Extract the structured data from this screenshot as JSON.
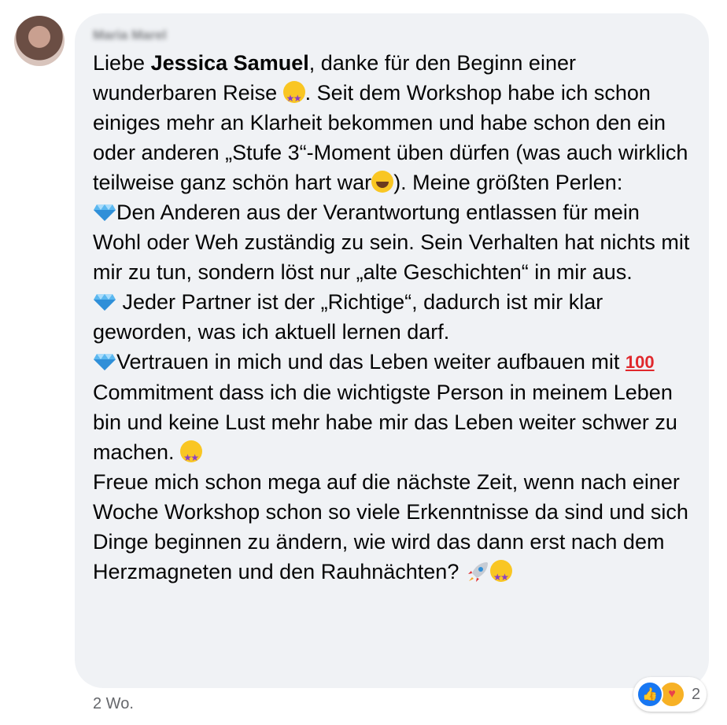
{
  "comment": {
    "author": "Maria Marel",
    "greeting": "Liebe ",
    "mention": "Jessica Samuel",
    "p1a": ", danke für den Beginn einer wunderbaren Reise ",
    "p1b": ". Seit dem Workshop habe ich schon einiges mehr an Klarheit bekommen und habe schon den ein oder anderen „Stufe 3“-Moment üben dürfen (was auch wirklich teilweise ganz schön hart war",
    "p1c": "). Meine größten Perlen:",
    "pearl1": "Den Anderen aus der Verantwortung entlassen für mein Wohl oder Weh zuständig zu sein. Sein Verhalten hat nichts mit mir zu tun, sondern löst nur „alte Geschichten“ in mir aus.",
    "pearl2": " Jeder Partner ist der „Richtige“, dadurch ist mir klar geworden, was ich aktuell lernen darf.",
    "pearl3a": "Vertrauen in mich und das Leben weiter aufbauen mit ",
    "hundred": "100",
    "pearl3b": " Commitment dass ich die wichtigste Person in meinem Leben bin und keine Lust mehr habe mir das Leben weiter schwer zu machen. ",
    "closing": "Freue mich schon mega auf die nächste Zeit, wenn nach einer Woche Workshop schon so viele Erkenntnisse da sind und sich Dinge beginnen zu ändern, wie wird das dann erst nach dem Herzmagneten und den Rauhnächten? ",
    "timestamp": "2 Wo.",
    "reaction_count": "2",
    "icons": [
      "star-struck-emoji",
      "sweat-smile-emoji",
      "gem-emoji",
      "hundred-points-emoji",
      "rocket-emoji",
      "like-reaction",
      "care-reaction"
    ],
    "colors": {
      "bubble": "#f0f2f5",
      "text": "#050505",
      "meta": "#65676b",
      "like": "#1877f2"
    }
  }
}
